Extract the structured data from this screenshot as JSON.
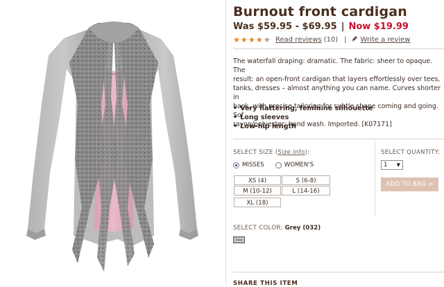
{
  "product": {
    "title": "Burnout front cardigan",
    "price": {
      "was": "Was $59.95 - $69.95",
      "separator": "|",
      "now": "Now $19.99"
    },
    "rating": {
      "stars": 4,
      "max_stars": 5,
      "reviews_link": "Read reviews",
      "review_count": "(10)",
      "separator": "|",
      "write_review_link": "Write a review"
    },
    "description": "The waterfall draping: dramatic. The fabric: sheer to opaque. The\nresult: an open-front cardigan that layers effortlessly over tees,\ntanks, dresses – almost anything you can name. Curves shorter in\nback, with precise tailoring for subtle shape coming and going. Sof\nrayon/polyester; hand wash. Imported. [K07171]",
    "features": [
      "Very flattering, feminine silhouette",
      "Long sleeves",
      "Low-hip length"
    ]
  },
  "size": {
    "label": "SELECT SIZE (",
    "info_link": "Size info",
    "label_end": "):",
    "categories": [
      {
        "label": "MISSES",
        "selected": true
      },
      {
        "label": "WOMEN'S",
        "selected": false
      }
    ],
    "options": [
      "XS (4)",
      "S (6-8)",
      "M (10-12)",
      "L (14-16)",
      "XL (18)"
    ]
  },
  "quantity": {
    "label": "SELECT QUANTITY:",
    "value": "1"
  },
  "add_to_bag_label": "ADD TO BAG >",
  "color": {
    "label": "SELECT COLOR:",
    "value": "Grey (032)",
    "swatch_hex": "#9a9a9a"
  },
  "share_label": "SHARE THIS ITEM",
  "colors": {
    "title": "#4a2e1e",
    "sale_price": "#c8102e",
    "star": "#e8801c",
    "add_to_bag_bg": "#ddc2b4"
  },
  "icons": {
    "star": "star-icon",
    "pencil": "pencil-icon",
    "radio": "radio-icon",
    "dropdown": "chevron-down-icon"
  }
}
